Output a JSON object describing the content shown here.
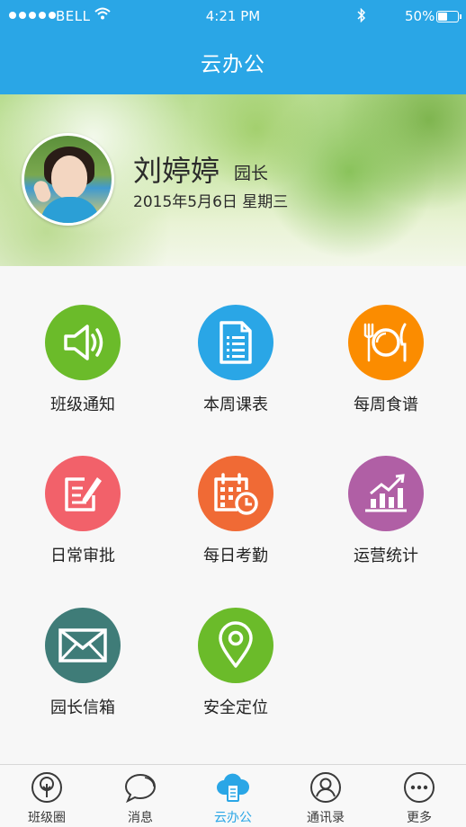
{
  "status_bar": {
    "carrier": "BELL",
    "time": "4:21 PM",
    "battery": "50%",
    "battery_level": 0.5
  },
  "header": {
    "title": "云办公"
  },
  "profile": {
    "name": "刘婷婷",
    "role": "园长",
    "date": "2015年5月6日  星期三"
  },
  "menu": [
    {
      "label": "班级通知",
      "icon": "speaker-icon",
      "color": "#6bbb2a"
    },
    {
      "label": "本周课表",
      "icon": "document-list-icon",
      "color": "#2aa6e6"
    },
    {
      "label": "每周食谱",
      "icon": "plate-cutlery-icon",
      "color": "#fb8c00"
    },
    {
      "label": "日常审批",
      "icon": "edit-note-icon",
      "color": "#f2616a"
    },
    {
      "label": "每日考勤",
      "icon": "calendar-clock-icon",
      "color": "#f06a35"
    },
    {
      "label": "运营统计",
      "icon": "bar-chart-icon",
      "color": "#b05fa5"
    },
    {
      "label": "园长信箱",
      "icon": "envelope-icon",
      "color": "#3f7c78"
    },
    {
      "label": "安全定位",
      "icon": "location-pin-icon",
      "color": "#6bbb2a"
    }
  ],
  "tabbar": {
    "items": [
      {
        "label": "班级圈",
        "icon": "tree-circle-icon"
      },
      {
        "label": "消息",
        "icon": "chat-bubble-icon"
      },
      {
        "label": "云办公",
        "icon": "cloud-doc-icon"
      },
      {
        "label": "通讯录",
        "icon": "contact-person-icon"
      },
      {
        "label": "更多",
        "icon": "more-dots-icon"
      }
    ],
    "active_index": 2,
    "active_color": "#2aa6e6"
  }
}
